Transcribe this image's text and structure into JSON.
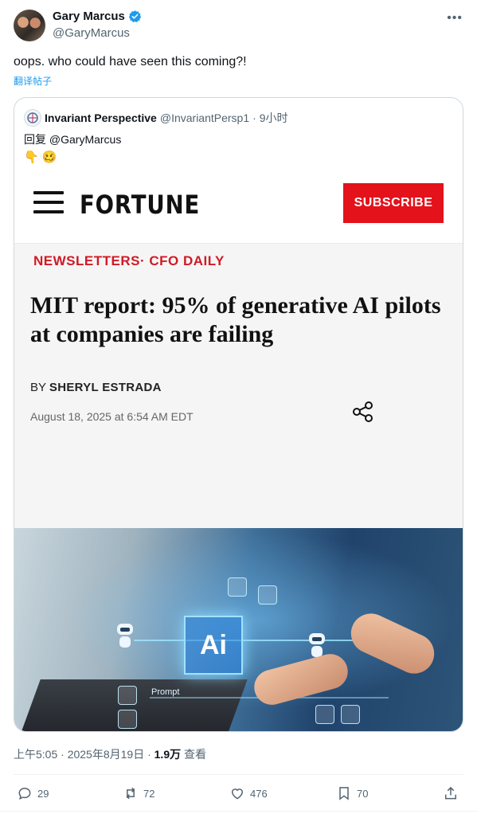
{
  "author": {
    "name": "Gary Marcus",
    "handle": "@GaryMarcus"
  },
  "tweet": {
    "text": "oops. who could have seen this coming?!",
    "translate_label": "翻译帖子"
  },
  "quote": {
    "author_name": "Invariant Perspective",
    "author_handle": "@InvariantPersp1",
    "time": "· 9小时",
    "reply_prefix": "回复",
    "reply_handle": "@GaryMarcus",
    "emojis": [
      "👇",
      "🥴"
    ]
  },
  "article": {
    "logo": "FORTUNE",
    "subscribe_label": "SUBSCRIBE",
    "kicker": "NEWSLETTERS· CFO DAILY",
    "headline": "MIT report: 95% of generative AI pilots at companies are failing",
    "byline_prefix": "BY",
    "byline_author": "SHERYL ESTRADA",
    "date": "August 18, 2025 at 6:54 AM EDT",
    "image_labels": {
      "ai": "Ai",
      "prompt": "Prompt"
    }
  },
  "meta": {
    "time": "上午5:05 · 2025年8月19日 ·",
    "views_count": "1.9万",
    "views_label": "查看"
  },
  "actions": {
    "replies": "29",
    "reposts": "72",
    "likes": "476",
    "bookmarks": "70"
  },
  "colors": {
    "verified": "#1d9bf0",
    "fortune_red": "#e3121b",
    "kicker_red": "#d01a26",
    "link_blue": "#1d9bf0"
  },
  "icons": {
    "verified": "verified-badge-icon",
    "more": "more-options-icon",
    "menu": "hamburger-menu-icon",
    "share": "share-nodes-icon",
    "reply": "reply-icon",
    "repost": "repost-icon",
    "like": "heart-icon",
    "bookmark": "bookmark-icon",
    "share_tweet": "share-upload-icon"
  }
}
